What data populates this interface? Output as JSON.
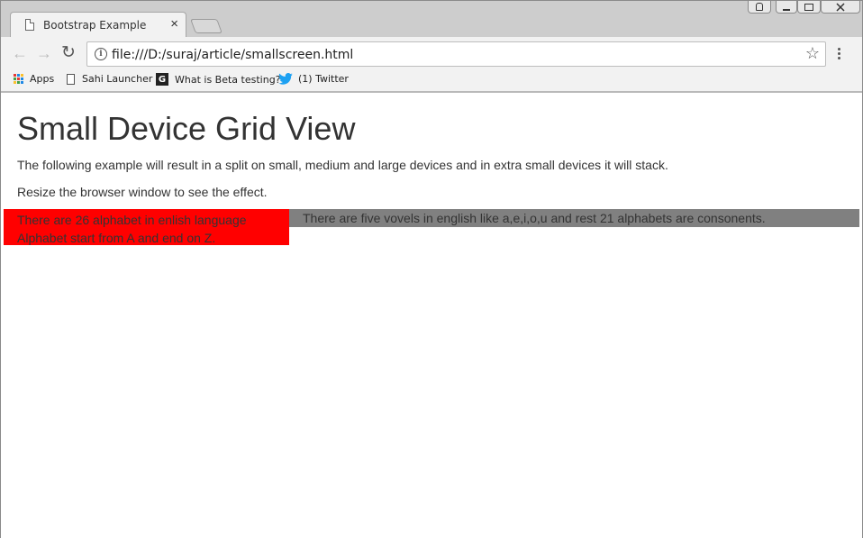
{
  "browser": {
    "tab_title": "Bootstrap Example",
    "tab_close": "×",
    "url": "file:///D:/suraj/article/smallscreen.html",
    "nav": {
      "back": "←",
      "forward": "→",
      "reload": "↻"
    },
    "star": "☆"
  },
  "bookmarks": [
    {
      "label": "Apps",
      "icon": "apps-grid-icon"
    },
    {
      "label": "Sahi Launcher",
      "icon": "page-icon"
    },
    {
      "label": "What is Beta testing?",
      "icon": "g-icon",
      "icon_text": "G"
    },
    {
      "label": "(1) Twitter",
      "icon": "twitter-icon"
    }
  ],
  "page": {
    "title": "Small Device Grid View",
    "paragraph1": "The following example will result in a split on small, medium and large devices and in extra small devices it will stack.",
    "paragraph2": "Resize the browser window to see the effect.",
    "col_left": {
      "line1": "There are 26 alphabet in enlish language",
      "line2": "Alphabet start from A and end on Z.",
      "bg": "#ff0000"
    },
    "col_right": {
      "text": "There are five vovels in english like a,e,i,o,u and rest 21 alphabets are consonents.",
      "bg": "#808080"
    }
  }
}
